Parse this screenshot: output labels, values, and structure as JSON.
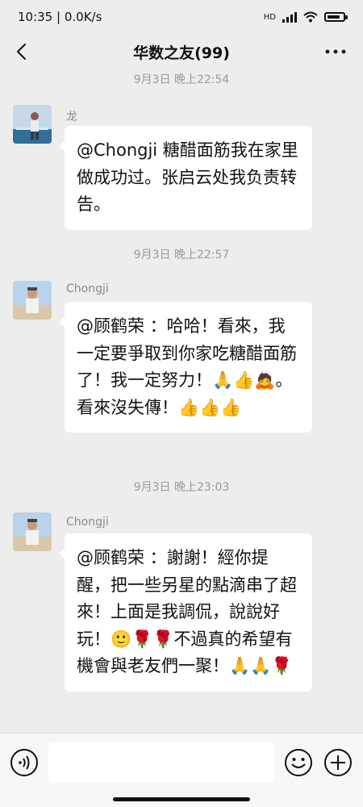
{
  "status_bar": {
    "time": "10:35",
    "network_speed": "0.0K/s",
    "hd_label": "HD",
    "battery_level": 0.85
  },
  "header": {
    "title": "华数之友(99)",
    "back_icon": "chevron-left-icon",
    "more_icon": "more-dots-icon"
  },
  "messages": [
    {
      "timestamp": "9月3日 晚上22:54",
      "sender": "龙",
      "text": "@Chongji 糖醋面筋我在家里做成功过。张启云处我负责转告。"
    },
    {
      "timestamp": "9月3日 晚上22:57",
      "sender": "Chongji",
      "text": "@顾鹤荣 ：哈哈！看來，我一定要爭取到你家吃糖醋面筋了！我一定努力！🙏👍🙇。 看來沒失傳！👍👍👍"
    },
    {
      "timestamp": "9月3日 晚上23:03",
      "sender": "Chongji",
      "text": "@顾鹤荣 ：謝謝！經你提醒，把一些另星的點滴串了超來！上面是我調侃，說說好玩！🙂🌹🌹不過真的希望有機會與老友們一聚！🙏🙏🌹"
    }
  ],
  "input_bar": {
    "voice_icon": "voice-icon",
    "emoji_icon": "emoji-smile-icon",
    "plus_icon": "plus-circle-icon",
    "input_value": ""
  }
}
